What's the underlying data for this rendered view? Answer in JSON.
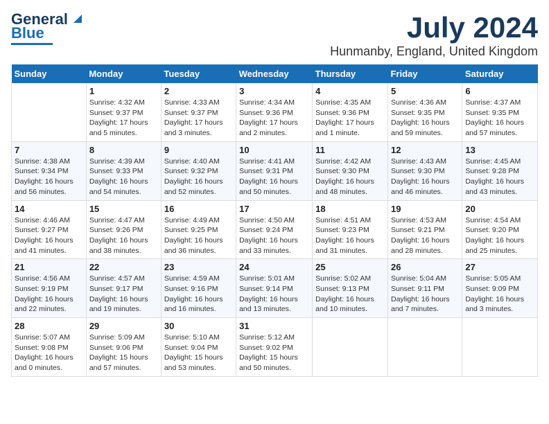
{
  "header": {
    "logo_line1": "General",
    "logo_line2": "Blue",
    "main_title": "July 2024",
    "subtitle": "Hunmanby, England, United Kingdom"
  },
  "calendar": {
    "days_of_week": [
      "Sunday",
      "Monday",
      "Tuesday",
      "Wednesday",
      "Thursday",
      "Friday",
      "Saturday"
    ],
    "weeks": [
      [
        {
          "day": "",
          "info": ""
        },
        {
          "day": "1",
          "info": "Sunrise: 4:32 AM\nSunset: 9:37 PM\nDaylight: 17 hours\nand 5 minutes."
        },
        {
          "day": "2",
          "info": "Sunrise: 4:33 AM\nSunset: 9:37 PM\nDaylight: 17 hours\nand 3 minutes."
        },
        {
          "day": "3",
          "info": "Sunrise: 4:34 AM\nSunset: 9:36 PM\nDaylight: 17 hours\nand 2 minutes."
        },
        {
          "day": "4",
          "info": "Sunrise: 4:35 AM\nSunset: 9:36 PM\nDaylight: 17 hours\nand 1 minute."
        },
        {
          "day": "5",
          "info": "Sunrise: 4:36 AM\nSunset: 9:35 PM\nDaylight: 16 hours\nand 59 minutes."
        },
        {
          "day": "6",
          "info": "Sunrise: 4:37 AM\nSunset: 9:35 PM\nDaylight: 16 hours\nand 57 minutes."
        }
      ],
      [
        {
          "day": "7",
          "info": "Sunrise: 4:38 AM\nSunset: 9:34 PM\nDaylight: 16 hours\nand 56 minutes."
        },
        {
          "day": "8",
          "info": "Sunrise: 4:39 AM\nSunset: 9:33 PM\nDaylight: 16 hours\nand 54 minutes."
        },
        {
          "day": "9",
          "info": "Sunrise: 4:40 AM\nSunset: 9:32 PM\nDaylight: 16 hours\nand 52 minutes."
        },
        {
          "day": "10",
          "info": "Sunrise: 4:41 AM\nSunset: 9:31 PM\nDaylight: 16 hours\nand 50 minutes."
        },
        {
          "day": "11",
          "info": "Sunrise: 4:42 AM\nSunset: 9:30 PM\nDaylight: 16 hours\nand 48 minutes."
        },
        {
          "day": "12",
          "info": "Sunrise: 4:43 AM\nSunset: 9:30 PM\nDaylight: 16 hours\nand 46 minutes."
        },
        {
          "day": "13",
          "info": "Sunrise: 4:45 AM\nSunset: 9:28 PM\nDaylight: 16 hours\nand 43 minutes."
        }
      ],
      [
        {
          "day": "14",
          "info": "Sunrise: 4:46 AM\nSunset: 9:27 PM\nDaylight: 16 hours\nand 41 minutes."
        },
        {
          "day": "15",
          "info": "Sunrise: 4:47 AM\nSunset: 9:26 PM\nDaylight: 16 hours\nand 38 minutes."
        },
        {
          "day": "16",
          "info": "Sunrise: 4:49 AM\nSunset: 9:25 PM\nDaylight: 16 hours\nand 36 minutes."
        },
        {
          "day": "17",
          "info": "Sunrise: 4:50 AM\nSunset: 9:24 PM\nDaylight: 16 hours\nand 33 minutes."
        },
        {
          "day": "18",
          "info": "Sunrise: 4:51 AM\nSunset: 9:23 PM\nDaylight: 16 hours\nand 31 minutes."
        },
        {
          "day": "19",
          "info": "Sunrise: 4:53 AM\nSunset: 9:21 PM\nDaylight: 16 hours\nand 28 minutes."
        },
        {
          "day": "20",
          "info": "Sunrise: 4:54 AM\nSunset: 9:20 PM\nDaylight: 16 hours\nand 25 minutes."
        }
      ],
      [
        {
          "day": "21",
          "info": "Sunrise: 4:56 AM\nSunset: 9:19 PM\nDaylight: 16 hours\nand 22 minutes."
        },
        {
          "day": "22",
          "info": "Sunrise: 4:57 AM\nSunset: 9:17 PM\nDaylight: 16 hours\nand 19 minutes."
        },
        {
          "day": "23",
          "info": "Sunrise: 4:59 AM\nSunset: 9:16 PM\nDaylight: 16 hours\nand 16 minutes."
        },
        {
          "day": "24",
          "info": "Sunrise: 5:01 AM\nSunset: 9:14 PM\nDaylight: 16 hours\nand 13 minutes."
        },
        {
          "day": "25",
          "info": "Sunrise: 5:02 AM\nSunset: 9:13 PM\nDaylight: 16 hours\nand 10 minutes."
        },
        {
          "day": "26",
          "info": "Sunrise: 5:04 AM\nSunset: 9:11 PM\nDaylight: 16 hours\nand 7 minutes."
        },
        {
          "day": "27",
          "info": "Sunrise: 5:05 AM\nSunset: 9:09 PM\nDaylight: 16 hours\nand 3 minutes."
        }
      ],
      [
        {
          "day": "28",
          "info": "Sunrise: 5:07 AM\nSunset: 9:08 PM\nDaylight: 16 hours\nand 0 minutes."
        },
        {
          "day": "29",
          "info": "Sunrise: 5:09 AM\nSunset: 9:06 PM\nDaylight: 15 hours\nand 57 minutes."
        },
        {
          "day": "30",
          "info": "Sunrise: 5:10 AM\nSunset: 9:04 PM\nDaylight: 15 hours\nand 53 minutes."
        },
        {
          "day": "31",
          "info": "Sunrise: 5:12 AM\nSunset: 9:02 PM\nDaylight: 15 hours\nand 50 minutes."
        },
        {
          "day": "",
          "info": ""
        },
        {
          "day": "",
          "info": ""
        },
        {
          "day": "",
          "info": ""
        }
      ]
    ]
  }
}
